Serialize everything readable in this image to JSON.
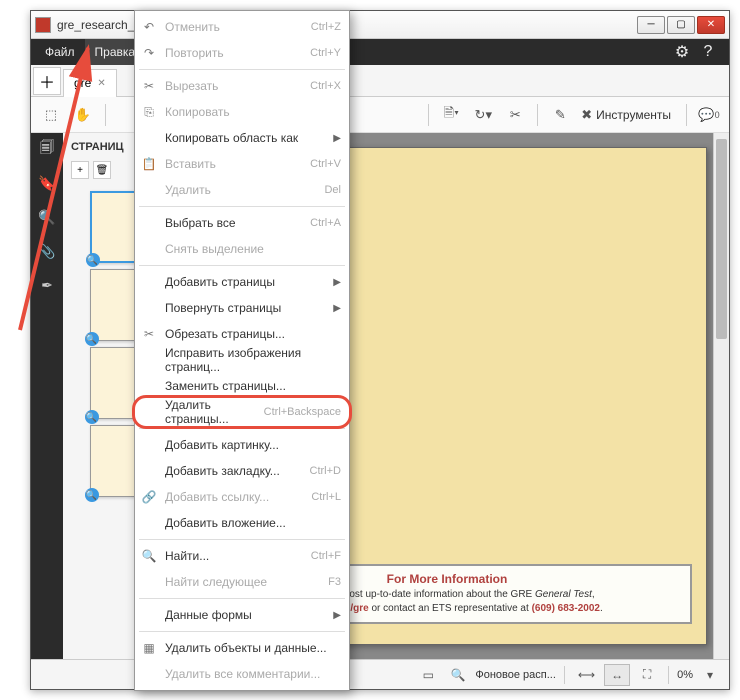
{
  "window": {
    "title": "gre_research_va"
  },
  "menubar": {
    "items": [
      "Файл",
      "Правка"
    ],
    "active_index": 1
  },
  "tabs": {
    "tab_label": "gre"
  },
  "toolbar": {
    "tools_label": "Инструменты"
  },
  "sidebar": {
    "panel_title": "СТРАНИЦ"
  },
  "context_menu": {
    "groups": [
      [
        {
          "label": "Отменить",
          "shortcut": "Ctrl+Z",
          "disabled": true,
          "icon": "↶"
        },
        {
          "label": "Повторить",
          "shortcut": "Ctrl+Y",
          "disabled": true,
          "icon": "↷"
        }
      ],
      [
        {
          "label": "Вырезать",
          "shortcut": "Ctrl+X",
          "disabled": true,
          "icon": "✂"
        },
        {
          "label": "Копировать",
          "shortcut": "",
          "disabled": true,
          "icon": "⎘"
        },
        {
          "label": "Копировать область как",
          "submenu": true,
          "disabled": false
        },
        {
          "label": "Вставить",
          "shortcut": "Ctrl+V",
          "disabled": true,
          "icon": "📋"
        },
        {
          "label": "Удалить",
          "shortcut": "Del",
          "disabled": true
        }
      ],
      [
        {
          "label": "Выбрать все",
          "shortcut": "Ctrl+A",
          "disabled": false
        },
        {
          "label": "Снять выделение",
          "disabled": true
        }
      ],
      [
        {
          "label": "Добавить страницы",
          "submenu": true,
          "disabled": false
        },
        {
          "label": "Повернуть страницы",
          "submenu": true,
          "disabled": false
        },
        {
          "label": "Обрезать страницы...",
          "disabled": false,
          "icon": "✂"
        },
        {
          "label": "Исправить изображения страниц...",
          "disabled": false
        },
        {
          "label": "Заменить страницы...",
          "disabled": false
        },
        {
          "label": "Удалить страницы...",
          "shortcut": "Ctrl+Backspace",
          "disabled": false,
          "highlight": true
        }
      ],
      [
        {
          "label": "Добавить картинку...",
          "disabled": false
        },
        {
          "label": "Добавить закладку...",
          "shortcut": "Ctrl+D",
          "disabled": false
        },
        {
          "label": "Добавить ссылку...",
          "shortcut": "Ctrl+L",
          "disabled": true,
          "icon": "🔗"
        },
        {
          "label": "Добавить вложение...",
          "disabled": false
        }
      ],
      [
        {
          "label": "Найти...",
          "shortcut": "Ctrl+F",
          "disabled": false,
          "icon": "🔍"
        },
        {
          "label": "Найти следующее",
          "shortcut": "F3",
          "disabled": true
        }
      ],
      [
        {
          "label": "Данные формы",
          "submenu": true,
          "disabled": false
        }
      ],
      [
        {
          "label": "Удалить объекты и данные...",
          "disabled": false,
          "icon": "▦"
        },
        {
          "label": "Удалить все комментарии...",
          "disabled": true
        }
      ]
    ]
  },
  "document": {
    "info_title": "For More Information",
    "info_line1_a": "o get the most up-to-date information about the GRE ",
    "info_line1_b": "General Test",
    "info_line1_c": ",",
    "info_line2_a": "www.ets.org/gre",
    "info_line2_b": " or contact an ETS representative at ",
    "info_line2_c": "(609) 683-2002",
    "info_line2_d": "."
  },
  "statusbar": {
    "fit_label": "Фоновое расп...",
    "zoom_value": "0%"
  }
}
